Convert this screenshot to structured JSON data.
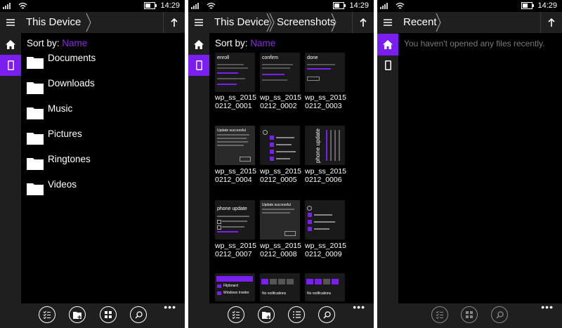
{
  "status": {
    "time": "14:29"
  },
  "panels": [
    {
      "breadcrumbs": [
        "This Device"
      ],
      "sort_label": "Sort by:",
      "sort_value": "Name",
      "folders": [
        "Documents",
        "Downloads",
        "Music",
        "Pictures",
        "Ringtones",
        "Videos"
      ]
    },
    {
      "breadcrumbs": [
        "This Device",
        "Screenshots"
      ],
      "sort_label": "Sort by:",
      "sort_value": "Name",
      "thumbs": [
        {
          "line1": "wp_ss_2015",
          "line2": "0212_0001",
          "text": "enroll"
        },
        {
          "line1": "wp_ss_2015",
          "line2": "0212_0002",
          "text": "confirm"
        },
        {
          "line1": "wp_ss_2015",
          "line2": "0212_0003",
          "text": "done"
        },
        {
          "line1": "wp_ss_2015",
          "line2": "0212_0004",
          "text": "Update successful"
        },
        {
          "line1": "wp_ss_2015",
          "line2": "0212_0005",
          "text": ""
        },
        {
          "line1": "wp_ss_2015",
          "line2": "0212_0006",
          "text": "phone update"
        },
        {
          "line1": "wp_ss_2015",
          "line2": "0212_0007",
          "text": "phone update"
        },
        {
          "line1": "wp_ss_2015",
          "line2": "0212_0008",
          "text": "Update successful"
        },
        {
          "line1": "wp_ss_2015",
          "line2": "0212_0009",
          "text": ""
        }
      ],
      "bottom_thumb_texts": [
        "Flipboard",
        "Windows Insider",
        "No notifications",
        "No notifications"
      ]
    },
    {
      "breadcrumbs": [
        "Recent"
      ],
      "empty_message": "You haven't opened any files recently."
    }
  ],
  "appbar": {
    "icons": [
      "select-icon",
      "new-folder-icon",
      "view-icon",
      "search-icon"
    ],
    "more": "•••"
  },
  "colors": {
    "accent": "#7b1ef2",
    "chrome": "#1f1f1f",
    "background": "#000000"
  }
}
